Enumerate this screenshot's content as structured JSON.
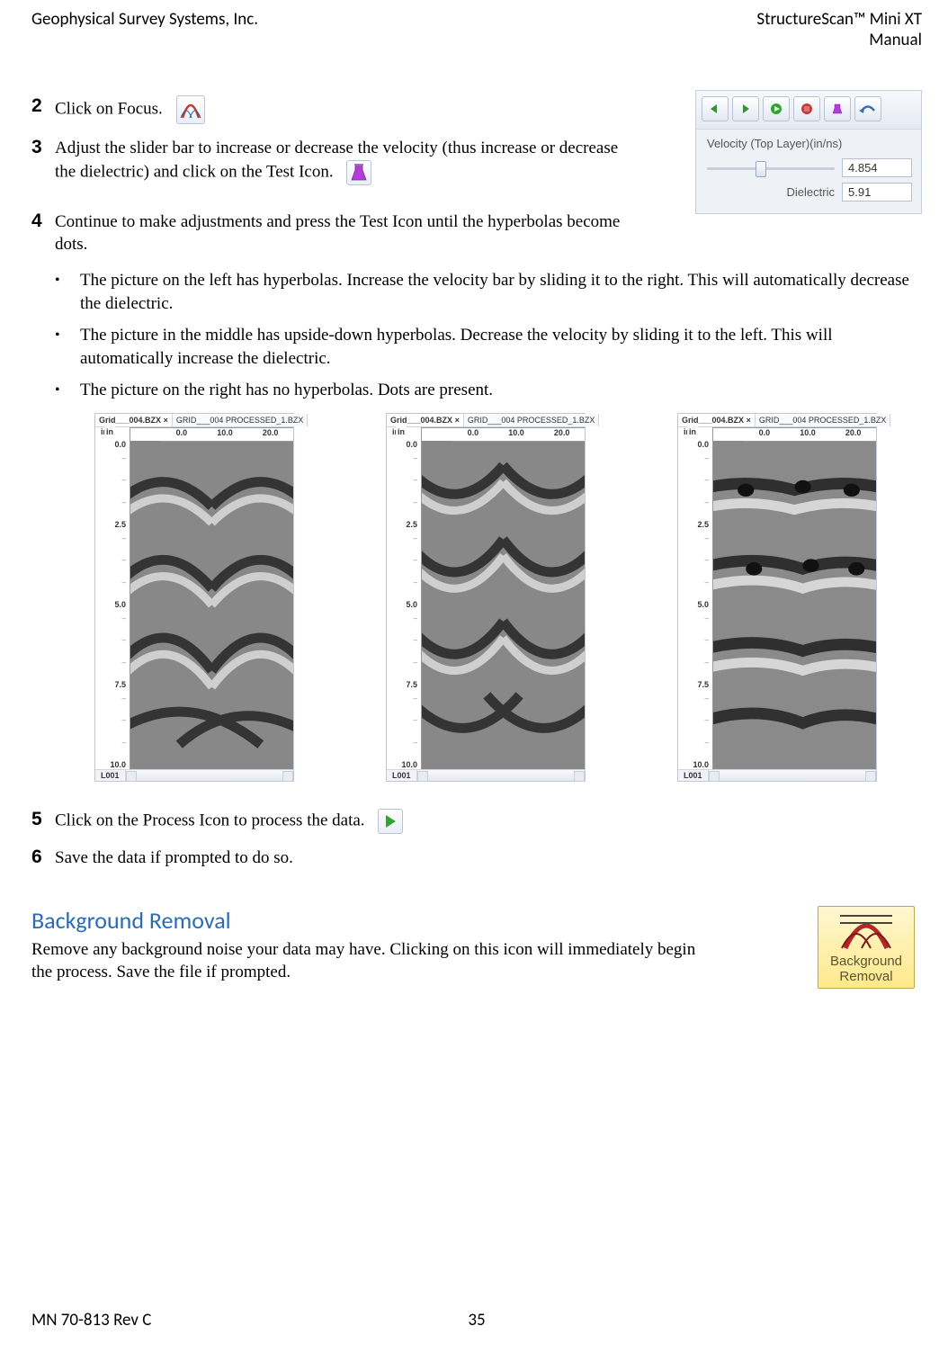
{
  "header": {
    "left": "Geophysical Survey Systems, Inc.",
    "right_line1": "StructureScan™ Mini XT",
    "right_line2": "Manual"
  },
  "footer": {
    "left": "MN 70-813 Rev C",
    "center": "35"
  },
  "steps": {
    "s2_num": "2",
    "s2_text": "Click on Focus.",
    "s3_num": "3",
    "s3_text": "Adjust the slider bar to increase or decrease the velocity (thus increase or decrease the dielectric) and click on the Test Icon.",
    "s4_num": "4",
    "s4_text": "Continue to make adjustments and press the Test Icon until the hyperbolas become dots.",
    "s5_num": "5",
    "s5_text": "Click on the Process Icon to process the data.",
    "s6_num": "6",
    "s6_text": "Save the data if prompted to do so."
  },
  "bullets": {
    "b1": "The picture on the left has hyperbolas. Increase the velocity bar by sliding it to the right. This will automatically decrease the dielectric.",
    "b2": "The picture in the middle has upside-down hyperbolas. Decrease the velocity by sliding it to the left. This will automatically increase the dielectric.",
    "b3": "The picture on the right has no hyperbolas. Dots are present."
  },
  "velocity_panel": {
    "title": "Velocity (Top Layer)(in/ns)",
    "velocity_value": "4.854",
    "dielectric_label": "Dielectric",
    "dielectric_value": "5.91"
  },
  "plot_meta": {
    "tab1": "Grid___004.BZX",
    "tab_close": "×",
    "tab2": "GRID___004 PROCESSED_1.BZX",
    "x_unit": "in",
    "y_unit": "in",
    "x_ticks": [
      "0.0",
      "10.0",
      "20.0"
    ],
    "y_ticks": [
      "0.0",
      "2.5",
      "5.0",
      "7.5",
      "10.0"
    ],
    "foot_label": "L001"
  },
  "section": {
    "title": "Background Removal",
    "text": "Remove any background noise your data may have. Clicking on this icon will immediately begin the process. Save the file if prompted."
  },
  "bgremove": {
    "line1": "Background",
    "line2": "Removal"
  }
}
